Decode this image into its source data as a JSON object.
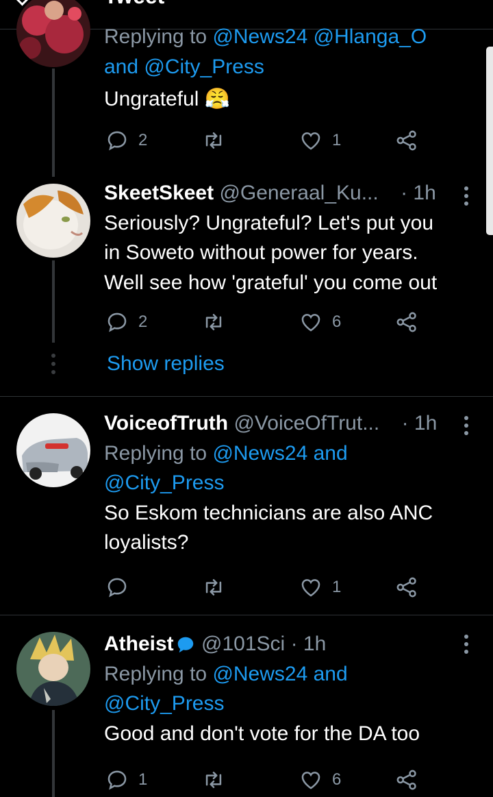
{
  "header": {
    "title": "Tweet"
  },
  "tweets": [
    {
      "name": "",
      "handle": "",
      "time": "",
      "reply_prefix": "Replying to",
      "reply_to_line1": "@News24 @Hlanga_O",
      "reply_to_line2_and": "and",
      "reply_to_line2": "@City_Press",
      "text_lines": [
        "Ungrateful 😤"
      ],
      "replies": "2",
      "retweets": "",
      "likes": "1"
    },
    {
      "name": "SkeetSkeet",
      "handle": "@Generaal_Ku...",
      "time": "· 1h",
      "text_lines": [
        "Seriously? Ungrateful? Let's put you",
        "in Soweto without power for years.",
        "Well see how 'grateful' you come out"
      ],
      "replies": "2",
      "retweets": "",
      "likes": "6",
      "show_replies": "Show replies"
    },
    {
      "name": "VoiceofTruth",
      "handle": "@VoiceOfTrut...",
      "time": "· 1h",
      "reply_prefix": "Replying to",
      "reply_to_line1": "@News24 and",
      "reply_to_line2": "@City_Press",
      "text_lines": [
        "So Eskom technicians are also ANC",
        "loyalists?"
      ],
      "replies": "",
      "retweets": "",
      "likes": "1"
    },
    {
      "name": "Atheist",
      "handle": "@101Sci",
      "time": "· 1h",
      "reply_prefix": "Replying to",
      "reply_to_line1": "@News24 and",
      "reply_to_line2": "@City_Press",
      "text_lines": [
        "Good and don't vote for the DA too"
      ],
      "replies": "1",
      "retweets": "",
      "likes": "6"
    }
  ],
  "colors": {
    "background": "#000000",
    "link": "#1d9bf0",
    "muted": "#8b98a5",
    "divider": "#2f3336"
  }
}
